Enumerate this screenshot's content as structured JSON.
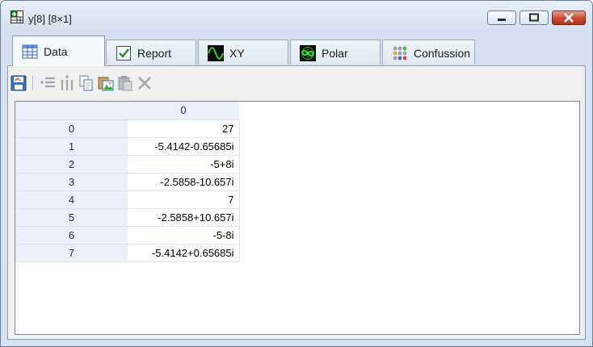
{
  "window": {
    "title": "y[8] [8×1]"
  },
  "tabs": [
    {
      "label": "Data",
      "icon": "table-icon",
      "active": true
    },
    {
      "label": "Report",
      "icon": "checkbox-icon",
      "active": false
    },
    {
      "label": "XY",
      "icon": "sine-wave-icon",
      "active": false
    },
    {
      "label": "Polar",
      "icon": "polar-icon",
      "active": false
    },
    {
      "label": "Confussion",
      "icon": "dot-matrix-icon",
      "active": false
    }
  ],
  "toolbar": [
    "save-icon",
    "insert-row-icon",
    "insert-column-icon",
    "copy-icon",
    "paste-image-icon",
    "paste-icon",
    "delete-icon"
  ],
  "grid": {
    "column_header": "0",
    "row_headers": [
      "0",
      "1",
      "2",
      "3",
      "4",
      "5",
      "6",
      "7"
    ],
    "values": [
      "27",
      "-5.4142-0.65685i",
      "-5+8i",
      "-2.5858-10.657i",
      "7",
      "-2.5858+10.657i",
      "-5-8i",
      "-5.4142+0.65685i"
    ]
  },
  "colors": {
    "header_bg": "#ebeefb",
    "chrome_bg": "#d5e1f0",
    "close_red": "#c74a33"
  }
}
